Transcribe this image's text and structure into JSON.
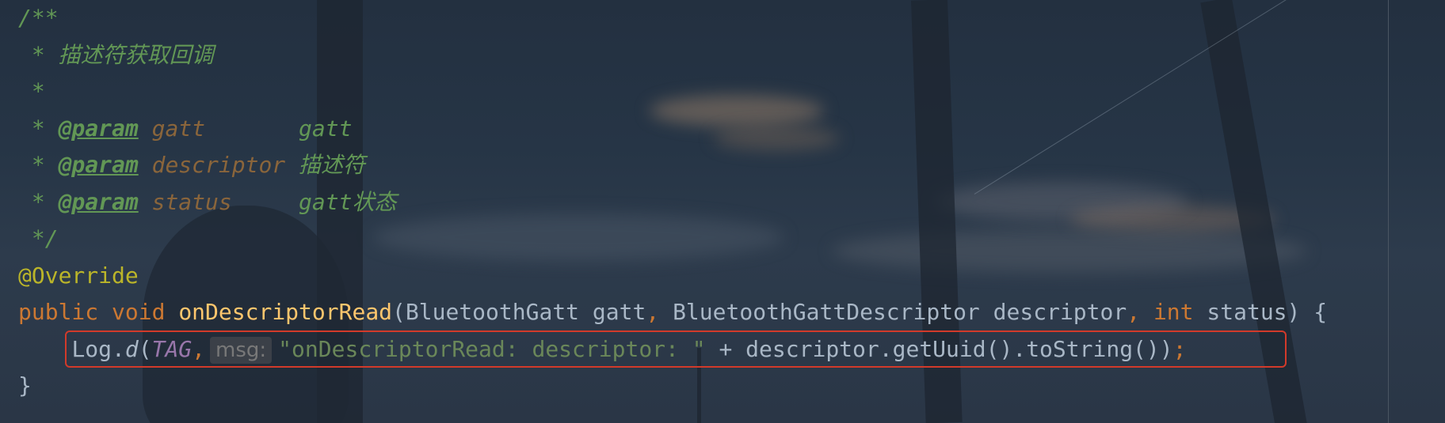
{
  "editor": {
    "code": {
      "doc_open": "/**",
      "doc_star": "*",
      "doc_desc": "描述符获取回调",
      "doc_empty_star": "*",
      "param_tag": "@param",
      "params": [
        {
          "name": "gatt",
          "desc": "gatt"
        },
        {
          "name": "descriptor",
          "desc": "描述符"
        },
        {
          "name": "status",
          "desc": "gatt状态"
        }
      ],
      "doc_close": "*/",
      "annotation": "@Override",
      "sig": {
        "public": "public",
        "void": "void",
        "method": "onDescriptorRead",
        "open_paren": "(",
        "type1": "BluetoothGatt",
        "arg1": "gatt",
        "comma1": ",",
        "type2": "BluetoothGattDescriptor",
        "arg2": "descriptor",
        "comma2": ",",
        "int": "int",
        "arg3": "status",
        "close": ") {"
      },
      "body": {
        "log": "Log.",
        "d": "d",
        "open": "(",
        "tag": "TAG",
        "comma": ",",
        "hint": "msg:",
        "string": "\"onDescriptorRead: descriptor: \"",
        "rest": " + descriptor.getUuid().toString())",
        "semi": ";"
      },
      "closing_brace": "}"
    },
    "colors": {
      "comment": "#629755",
      "keyword": "#cc7832",
      "method": "#ffc66d",
      "annotation": "#bbb529",
      "constant": "#9876aa",
      "string": "#6a8759",
      "highlight_border": "#d23a2a"
    }
  }
}
